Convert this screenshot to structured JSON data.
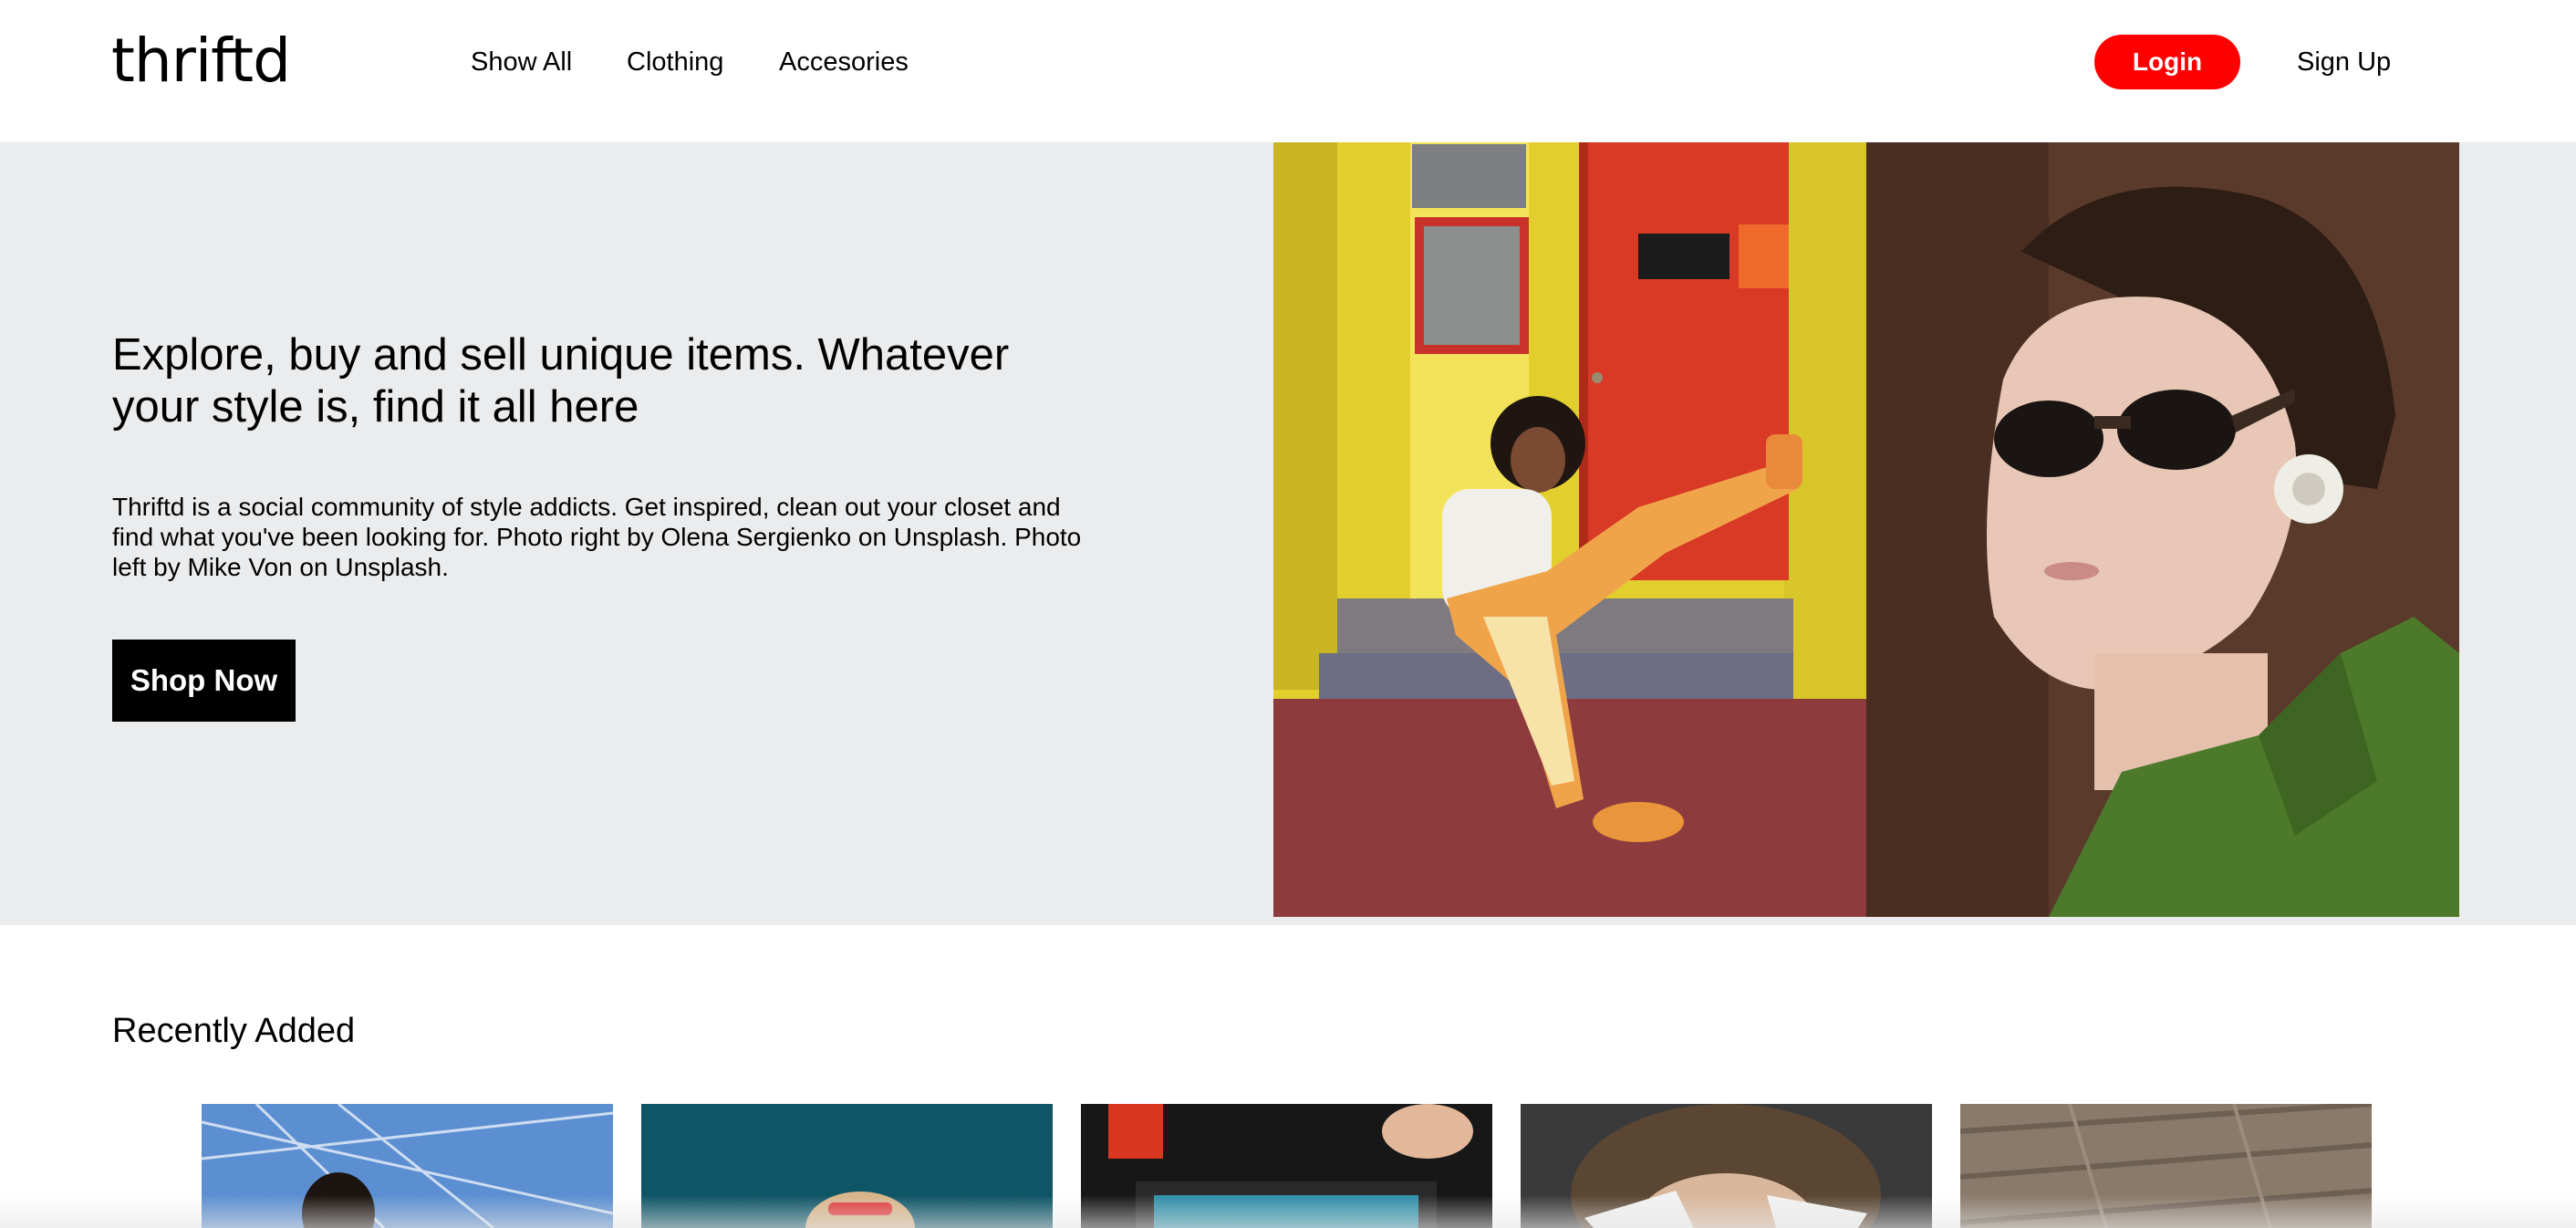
{
  "header": {
    "logo": "thriftd",
    "nav": [
      {
        "label": "Show All"
      },
      {
        "label": "Clothing"
      },
      {
        "label": "Accesories"
      }
    ],
    "login_label": "Login",
    "signup_label": "Sign Up",
    "accent_color": "#ff0000"
  },
  "hero": {
    "heading": "Explore, buy and sell unique items. Whatever your style is, find it all here",
    "body": "Thriftd is a social community of style addicts. Get inspired, clean out your closet and find what you've been looking for. Photo right by Olena Sergienko on Unsplash. Photo left by Mike Von on Unsplash.",
    "cta_label": "Shop Now",
    "background_color": "#ebecee"
  },
  "recently_added": {
    "title": "Recently Added",
    "product_count_visible": 5
  }
}
